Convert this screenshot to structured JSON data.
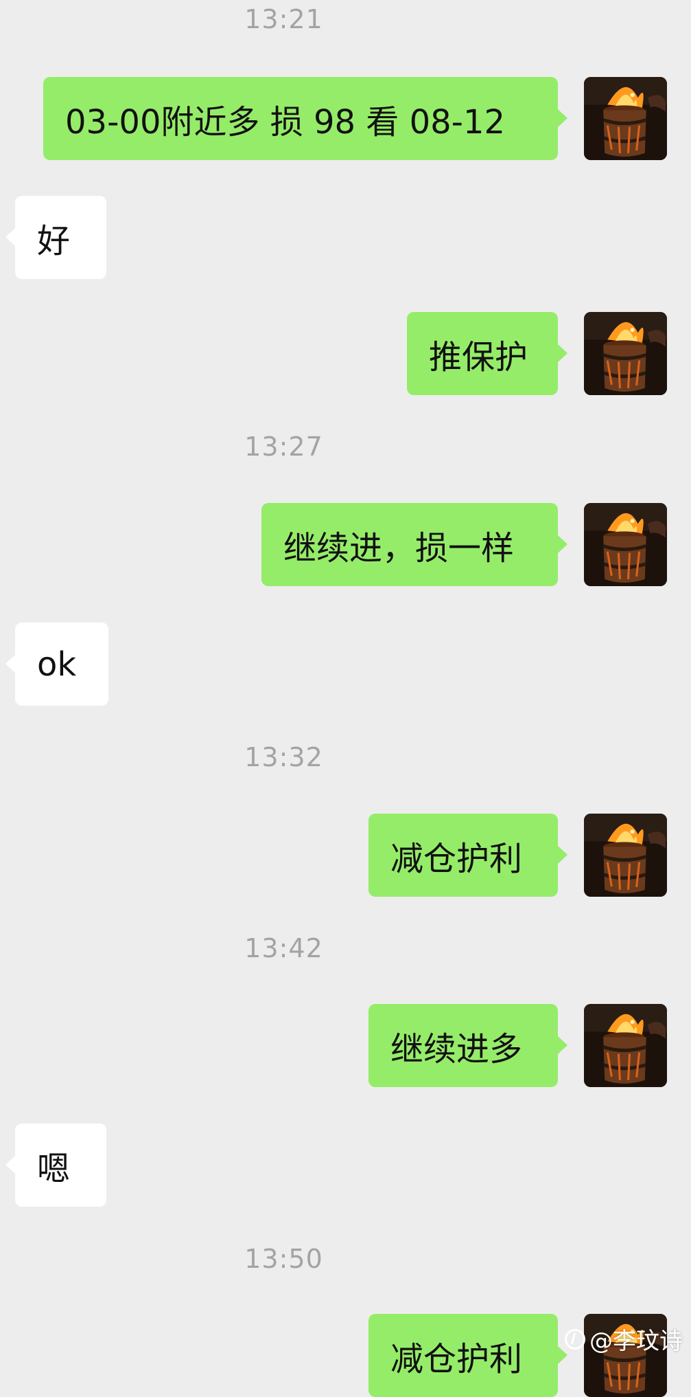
{
  "timestamps": [
    "13:21",
    "13:27",
    "13:32",
    "13:42",
    "13:50"
  ],
  "messages": [
    {
      "text": "03-00附近多  损 98  看 08-12",
      "side": "out"
    },
    {
      "text": "好",
      "side": "in"
    },
    {
      "text": "推保护",
      "side": "out"
    },
    {
      "text": "继续进，损一样",
      "side": "out"
    },
    {
      "text": "ok",
      "side": "in"
    },
    {
      "text": "减仓护利",
      "side": "out"
    },
    {
      "text": "继续进多",
      "side": "out"
    },
    {
      "text": "嗯",
      "side": "in"
    },
    {
      "text": "减仓护利",
      "side": "out"
    }
  ],
  "colors": {
    "background": "#ededed",
    "outgoing_bubble": "#95ec69",
    "incoming_bubble": "#ffffff",
    "timestamp_text": "#a3a3a3"
  },
  "avatar_icon": "fire-barrel-avatar",
  "watermark": {
    "text": "@李玟诗",
    "icon": "platform-logo-icon"
  }
}
